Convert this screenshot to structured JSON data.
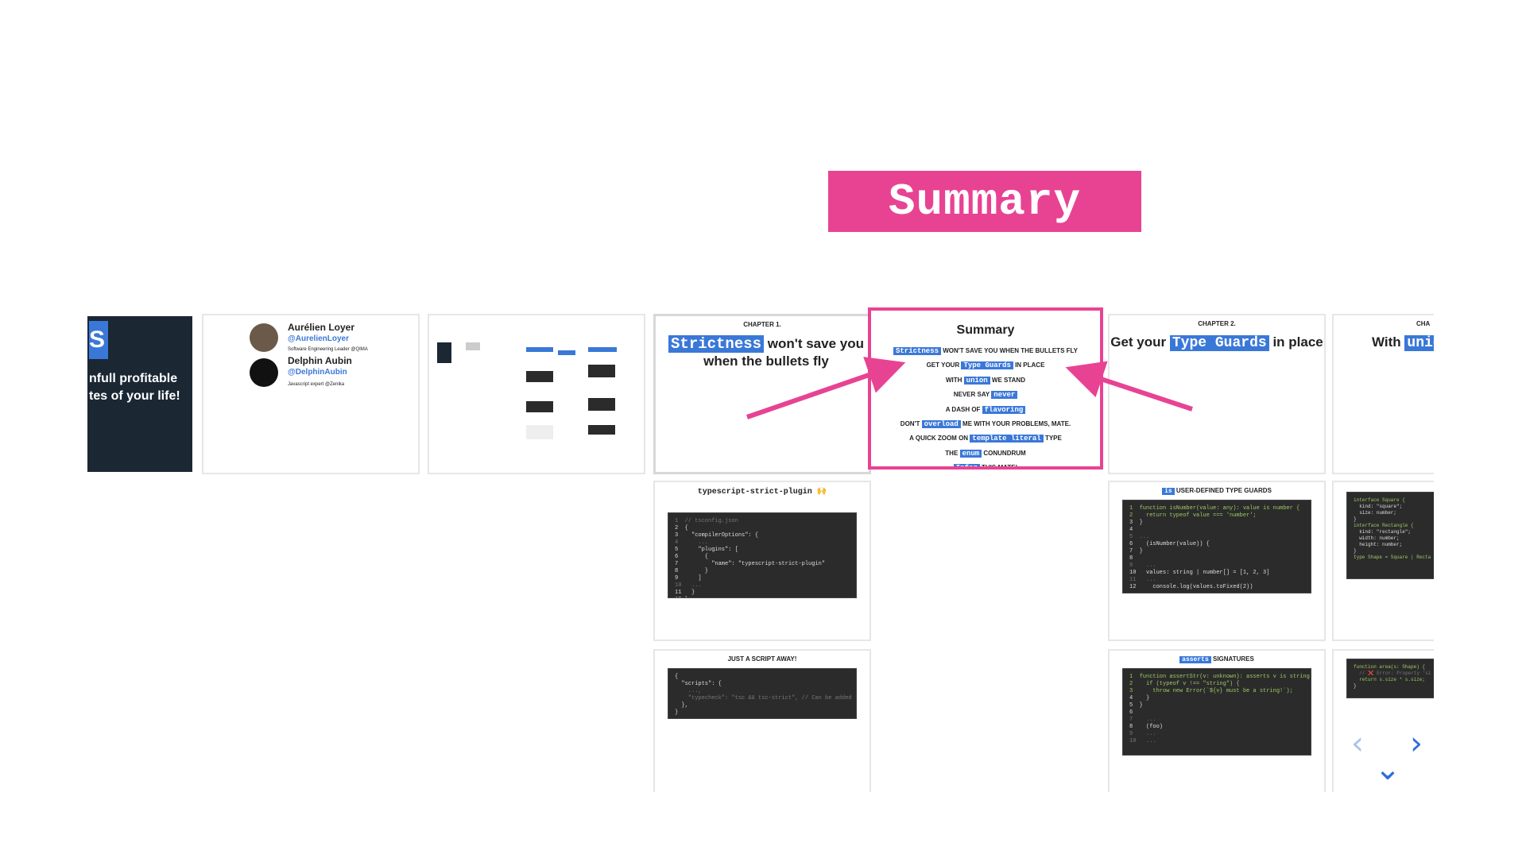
{
  "title": "Summary",
  "slide1": {
    "line1": "nfull profitable",
    "line2": "tes of your life!",
    "logo": "S"
  },
  "slide2": {
    "name1": "Aurélien Loyer",
    "handle1": "@AurelienLoyer",
    "role1": "Software Engineering Leader @QIMA",
    "name2": "Delphin Aubin",
    "handle2": "@DelphinAubin",
    "role2": "Javascript expert @Zenika"
  },
  "chapter1": {
    "label": "CHAPTER 1.",
    "hl": "Strictness",
    "rest1": "won't save you",
    "rest2": "when the bullets fly"
  },
  "summary": {
    "title": "Summary",
    "items": [
      {
        "pre": "",
        "hl": "Strictness",
        "post": "WON'T SAVE YOU WHEN THE BULLETS FLY"
      },
      {
        "pre": "GET YOUR",
        "hl": "Type Guards",
        "post": "IN PLACE"
      },
      {
        "pre": "WITH",
        "hl": "union",
        "post": "WE STAND"
      },
      {
        "pre": "NEVER SAY",
        "hl": "never",
        "post": ""
      },
      {
        "pre": "A DASH OF",
        "hl": "flavoring",
        "post": ""
      },
      {
        "pre": "DON'T",
        "hl": "overload",
        "post": "ME WITH YOUR PROBLEMS, MATE."
      },
      {
        "pre": "A QUICK ZOOM ON",
        "hl": "template literal",
        "post": "TYPE"
      },
      {
        "pre": "THE",
        "hl": "enum",
        "post": "CONUNDRUM"
      },
      {
        "pre": "",
        "hl": "Infer",
        "post": "THIS MATE!"
      }
    ]
  },
  "chapter2": {
    "label": "CHAPTER 2.",
    "pre": "Get your",
    "hl": "Type Guards",
    "post": "in place"
  },
  "chapter3": {
    "label": "CHA",
    "pre": "With",
    "hl": "unic"
  },
  "plugin": {
    "title": "typescript-strict-plugin 🙌"
  },
  "script": {
    "title": "JUST A SCRIPT AWAY!"
  },
  "isguards": {
    "hl": "is",
    "title": "USER-DEFINED TYPE GUARDS"
  },
  "asserts": {
    "hl": "asserts",
    "title": "SIGNATURES"
  },
  "code": {
    "plugin": [
      "1  // tsconfig.json",
      "2  {",
      "3    \"compilerOptions\": {",
      "4      ...",
      "5      \"plugins\": [",
      "6        {",
      "7          \"name\": \"typescript-strict-plugin\"",
      "8        }",
      "9      ]",
      "10   ...",
      "11   }",
      "12 }"
    ],
    "script": [
      "{",
      "  \"scripts\": {",
      "    ...,",
      "    \"typecheck\": \"tsc && tsc-strict\", // Can be added to CI",
      "  },",
      "}"
    ],
    "isguard": [
      "1  function isNumber(value: any): value is number {",
      "2    return typeof value === 'number';",
      "3  }",
      "4",
      "5  ...",
      "6    (isNumber(value)) {",
      "7  }",
      "8",
      "9    ...",
      "10   values: string | number[] = [1, 2, 3]",
      "11   ...",
      "12     console.log(values.toFixed(2))"
    ],
    "asserts": [
      "1  function assertStr(v: unknown): asserts v is string {",
      "2    if (typeof v !== \"string\") {",
      "3      throw new Error(`${v} must be a string!`);",
      "4    }",
      "5  }",
      "6",
      "7    ...",
      "8    (foo)",
      "9    ...",
      "10   ..."
    ],
    "shape": [
      "interface Square {",
      "  kind: \"square\";",
      "  size: number;",
      "}",
      "",
      "interface Rectangle {",
      "  kind: \"rectangle\";",
      "  width: number;",
      "  height: number;",
      "}",
      "",
      "type Shape = Square | Recta"
    ],
    "area": [
      "function area(s: Shape) {",
      "  // ❌ Error: Property 'si",
      "  return s.size * s.size;",
      "}"
    ]
  },
  "nav": {
    "prev": "‹",
    "next": "›",
    "down": "⌄"
  },
  "colors": {
    "accent": "#e84393",
    "highlight": "#3a78d8",
    "nav": "#2f6ed8"
  }
}
